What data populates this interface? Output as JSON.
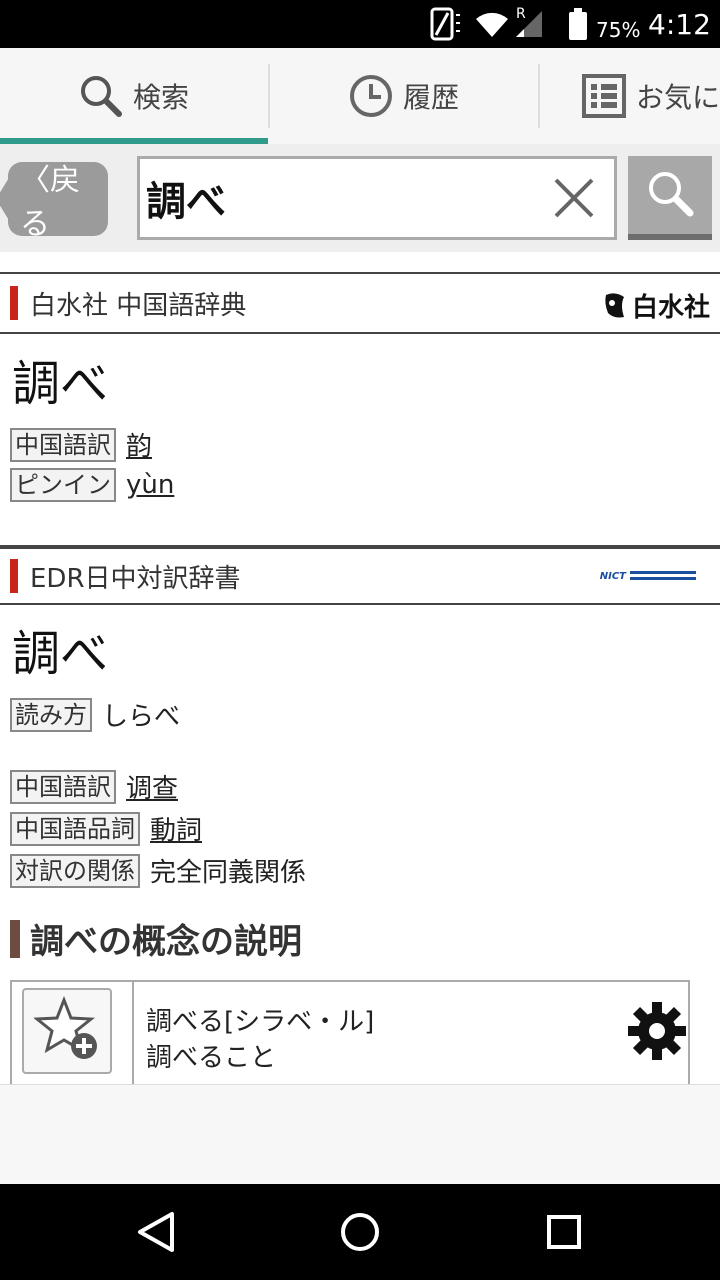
{
  "status_bar": {
    "battery_pct": "75%",
    "time": "4:12",
    "roaming": "R"
  },
  "tabs": [
    {
      "label": "検索",
      "icon": "search-icon"
    },
    {
      "label": "履歴",
      "icon": "clock-icon"
    },
    {
      "label": "お気に",
      "icon": "list-icon"
    }
  ],
  "search": {
    "back_label": "〈戻る",
    "query": "調べ"
  },
  "dict1": {
    "name": "白水社 中国語辞典",
    "logo_text": "白水社",
    "headword": "調べ",
    "fields": [
      {
        "tag": "中国語訳",
        "value": "韵"
      },
      {
        "tag": "ピンイン",
        "value": "yùn"
      }
    ]
  },
  "dict2": {
    "name": "EDR日中対訳辞書",
    "logo_text": "NICT",
    "headword": "調べ",
    "reading_tag": "読み方",
    "reading": "しらべ",
    "fields": [
      {
        "tag": "中国語訳",
        "value": "调查"
      },
      {
        "tag": "中国語品詞",
        "value": "動詞"
      },
      {
        "tag": "対訳の関係",
        "value": "完全同義関係"
      }
    ]
  },
  "concept": {
    "heading": "調べの概念の説明",
    "line1": "調べる[シラベ・ル]",
    "line2": "調べること"
  },
  "colors": {
    "accent": "#2f9a8a",
    "dict_bar": "#c8261c",
    "heading_bar": "#6d4c41"
  }
}
